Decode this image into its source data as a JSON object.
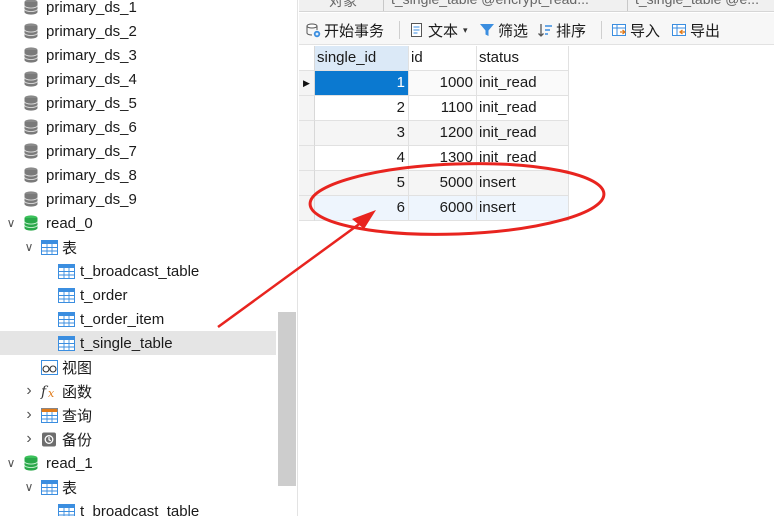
{
  "navigator": {
    "items": [
      {
        "label": "primary_ds_1",
        "kind": "db",
        "icon": "database-icon"
      },
      {
        "label": "primary_ds_2",
        "kind": "db",
        "icon": "database-icon"
      },
      {
        "label": "primary_ds_3",
        "kind": "db",
        "icon": "database-icon"
      },
      {
        "label": "primary_ds_4",
        "kind": "db",
        "icon": "database-icon"
      },
      {
        "label": "primary_ds_5",
        "kind": "db",
        "icon": "database-icon"
      },
      {
        "label": "primary_ds_6",
        "kind": "db",
        "icon": "database-icon"
      },
      {
        "label": "primary_ds_7",
        "kind": "db",
        "icon": "database-icon"
      },
      {
        "label": "primary_ds_8",
        "kind": "db",
        "icon": "database-icon"
      },
      {
        "label": "primary_ds_9",
        "kind": "db",
        "icon": "database-icon"
      },
      {
        "label": "read_0",
        "kind": "db-open",
        "icon": "database-open-icon"
      },
      {
        "label": "表",
        "kind": "folder-tables",
        "icon": "table-folder-icon"
      },
      {
        "label": "t_broadcast_table",
        "kind": "table",
        "icon": "table-icon"
      },
      {
        "label": "t_order",
        "kind": "table",
        "icon": "table-icon"
      },
      {
        "label": "t_order_item",
        "kind": "table",
        "icon": "table-icon"
      },
      {
        "label": "t_single_table",
        "kind": "table",
        "icon": "table-icon",
        "selected": true
      },
      {
        "label": "视图",
        "kind": "views",
        "icon": "view-icon"
      },
      {
        "label": "函数",
        "kind": "functions",
        "icon": "function-icon"
      },
      {
        "label": "查询",
        "kind": "queries",
        "icon": "query-icon"
      },
      {
        "label": "备份",
        "kind": "backups",
        "icon": "backup-icon"
      },
      {
        "label": "read_1",
        "kind": "db-open",
        "icon": "database-open-icon"
      },
      {
        "label": "表",
        "kind": "folder-tables",
        "icon": "table-folder-icon"
      },
      {
        "label": "t_broadcast_table",
        "kind": "table",
        "icon": "table-icon"
      }
    ]
  },
  "tabs": [
    {
      "label": "对象"
    },
    {
      "label": "t_single_table @encrypt_read..."
    },
    {
      "label": "t_single_table @e..."
    }
  ],
  "toolbar": {
    "begin_transaction": "开始事务",
    "text": "文本",
    "filter": "筛选",
    "sort": "排序",
    "import": "导入",
    "export": "导出"
  },
  "grid": {
    "columns": [
      "single_id",
      "id",
      "status"
    ],
    "rows": [
      {
        "single_id": "1",
        "id": "1000",
        "status": "init_read"
      },
      {
        "single_id": "2",
        "id": "1100",
        "status": "init_read"
      },
      {
        "single_id": "3",
        "id": "1200",
        "status": "init_read"
      },
      {
        "single_id": "4",
        "id": "1300",
        "status": "init_read"
      },
      {
        "single_id": "5",
        "id": "5000",
        "status": "insert"
      },
      {
        "single_id": "6",
        "id": "6000",
        "status": "insert"
      }
    ],
    "current_row_marker": "▶"
  },
  "colors": {
    "selection_blue": "#0b79d0",
    "header_selected": "#dbe9f7",
    "annotation_red": "#e8241f",
    "db_green": "#2aa84a"
  }
}
